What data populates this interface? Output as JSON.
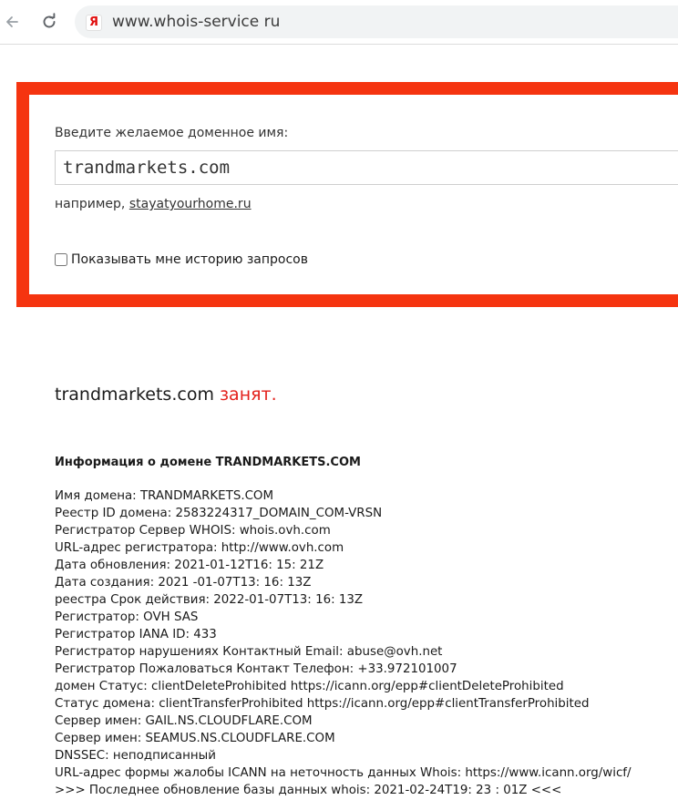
{
  "browser": {
    "url": "www.whois-service ru",
    "site_icon_glyph": "Я",
    "back_icon": "arrow-left-icon",
    "reload_icon": "reload-icon"
  },
  "form": {
    "prompt_label": "Введите желаемое доменное имя:",
    "domain_value": "trandmarkets.com",
    "example_prefix": "например,",
    "example_link": "stayatyourhome.ru",
    "history_label": "Показывать мне историю запросов",
    "history_checked": false,
    "frame_color": "#f53410"
  },
  "result": {
    "domain": "trandmarkets.com",
    "status": "занят.",
    "status_color": "#e3211c"
  },
  "info": {
    "heading": "Информация о домене TRANDMARKETS.COM",
    "lines": [
      "Имя домена: TRANDMARKETS.COM",
      "Реестр ID домена: 2583224317_DOMAIN_COM-VRSN",
      "Регистратор Сервер WHOIS: whois.ovh.com",
      "URL-адрес регистратора: http://www.ovh.com",
      "Дата обновления: 2021-01-12T16: 15: 21Z",
      "Дата создания: 2021 -01-07T13: 16: 13Z",
      "реестра Срок действия: 2022-01-07T13: 16: 13Z",
      "Регистратор: OVH SAS",
      "Регистратор IANA ID: 433",
      "Регистратор нарушениях Контактный Email: abuse@ovh.net",
      "Регистратор Пожаловаться Контакт Телефон: +33.972101007",
      "домен Статус: clientDeleteProhibited https://icann.org/epp#clientDeleteProhibited",
      "Статус домена: clientTransferProhibited https://icann.org/epp#clientTransferProhibited",
      "Сервер имен: GAIL.NS.CLOUDFLARE.COM",
      "Сервер имен: SEAMUS.NS.CLOUDFLARE.COM",
      "DNSSEC: неподписанный",
      "URL-адрес формы жалобы ICANN на неточность данных Whois: https://www.icann.org/wicf/",
      ">>> Последнее обновление базы данных whois: 2021-02-24T19: 23 : 01Z <<<"
    ]
  }
}
